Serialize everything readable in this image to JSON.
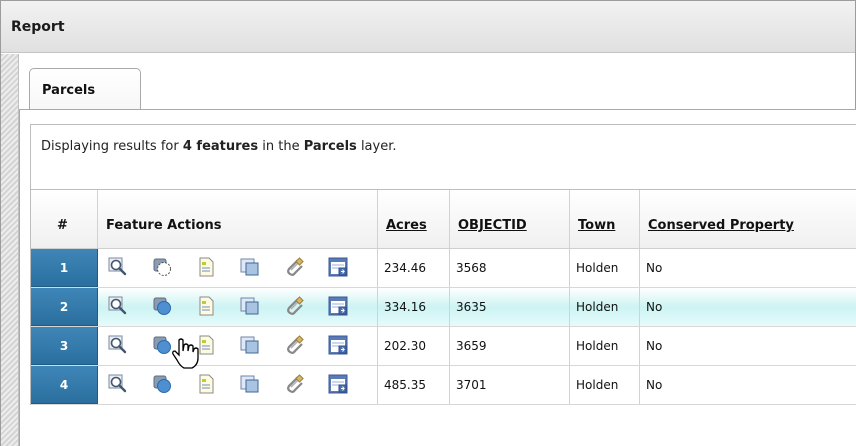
{
  "window": {
    "title": "Report"
  },
  "tabs": [
    {
      "label": "Parcels"
    }
  ],
  "summary": {
    "prefix": "Displaying results for ",
    "count_text": "4 features",
    "middle": " in the ",
    "layer": "Parcels",
    "suffix": " layer."
  },
  "table": {
    "headers": {
      "num": "#",
      "actions": "Feature Actions",
      "acres": "Acres",
      "objectid": "OBJECTID",
      "town": "Town",
      "conserved": "Conserved Property"
    },
    "action_icons": [
      "zoom-to-feature-icon",
      "select-feature-icon",
      "feature-details-icon",
      "copy-feature-icon",
      "attachments-icon",
      "export-feature-icon"
    ],
    "rows": [
      {
        "num": "1",
        "acres": "234.46",
        "objectid": "3568",
        "town": "Holden",
        "conserved": "No",
        "selected": false
      },
      {
        "num": "2",
        "acres": "334.16",
        "objectid": "3635",
        "town": "Holden",
        "conserved": "No",
        "selected": true
      },
      {
        "num": "3",
        "acres": "202.30",
        "objectid": "3659",
        "town": "Holden",
        "conserved": "No",
        "selected": true
      },
      {
        "num": "4",
        "acres": "485.35",
        "objectid": "3701",
        "town": "Holden",
        "conserved": "No",
        "selected": true
      }
    ],
    "hovered_row": 2
  },
  "colors": {
    "row_number_bg": "#2f78aa",
    "hover_row_bg": "#cdf3f3"
  }
}
